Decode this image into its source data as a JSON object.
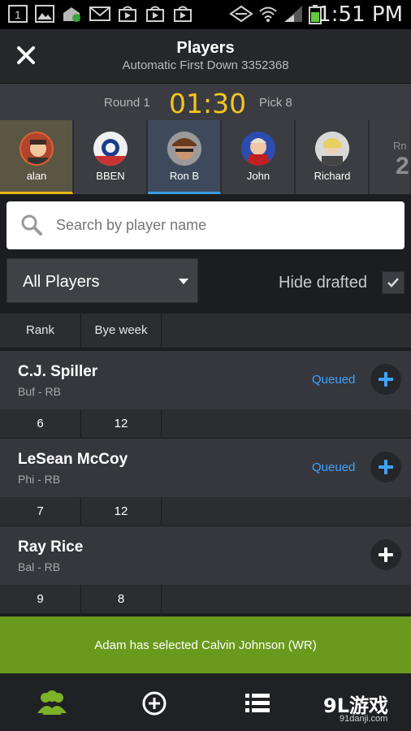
{
  "status_bar": {
    "time": "1:51 PM",
    "notification_badge": "1",
    "icons": [
      "badge-icon",
      "gallery-icon",
      "download-icon",
      "mail-icon",
      "play-store-icon",
      "play-store-icon",
      "play-store-icon",
      "sync-icon",
      "wifi-icon",
      "signal-icon",
      "battery-icon"
    ]
  },
  "header": {
    "title": "Players",
    "subtitle": "Automatic First Down 3352368",
    "close_icon": "close-icon"
  },
  "round_bar": {
    "round_label": "Round 1",
    "clock": "01:30",
    "pick_label": "Pick 8",
    "clock_color": "#f5c51e"
  },
  "drafters": [
    {
      "name": "alan",
      "state": "active"
    },
    {
      "name": "BBEN",
      "state": "normal"
    },
    {
      "name": "Ron B",
      "state": "selected"
    },
    {
      "name": "John",
      "state": "normal"
    },
    {
      "name": "Richard",
      "state": "normal"
    }
  ],
  "drafters_overflow": {
    "label": "Rn",
    "digit": "2"
  },
  "search": {
    "placeholder": "Search by player name",
    "icon": "search-icon"
  },
  "filter": {
    "selected": "All Players",
    "hide_drafted_label": "Hide drafted",
    "hide_drafted_checked": true
  },
  "columns": [
    "Rank",
    "Bye week"
  ],
  "players": [
    {
      "name": "C.J. Spiller",
      "team_pos": "Buf - RB",
      "status": "Queued",
      "queued": true,
      "rank": "6",
      "bye": "12"
    },
    {
      "name": "LeSean McCoy",
      "team_pos": "Phi - RB",
      "status": "Queued",
      "queued": true,
      "rank": "7",
      "bye": "12"
    },
    {
      "name": "Ray Rice",
      "team_pos": "Bal - RB",
      "status": "",
      "queued": false,
      "rank": "9",
      "bye": "8"
    }
  ],
  "toast": {
    "message": "Adam has selected Calvin Johnson (WR)",
    "color": "#6a9a1d"
  },
  "bottom_nav": {
    "items": [
      "players-icon",
      "add-icon",
      "list-icon"
    ],
    "active_color": "#7bb227"
  },
  "watermark": {
    "logo": "9L游戏",
    "url": "91danji.com"
  },
  "colors": {
    "accent_blue": "#3ea3ff",
    "active_gold": "#e8b814"
  }
}
